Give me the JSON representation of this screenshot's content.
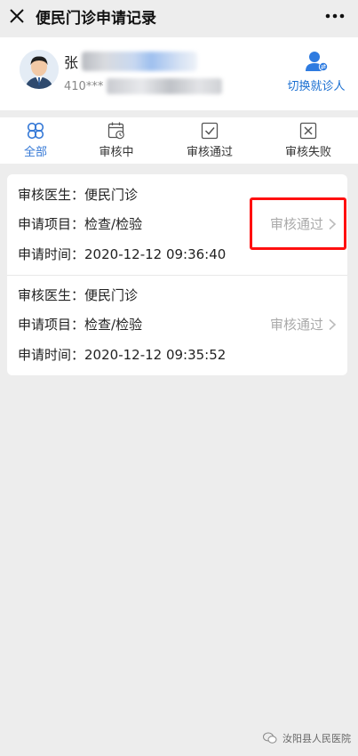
{
  "header": {
    "title": "便民门诊申请记录"
  },
  "user": {
    "name_visible": "张",
    "id_visible": "410***",
    "switch_label": "切换就诊人"
  },
  "tabs": [
    {
      "label": "全部",
      "icon": "four-petal-icon"
    },
    {
      "label": "审核中",
      "icon": "calendar-clock-icon"
    },
    {
      "label": "审核通过",
      "icon": "check-box-icon"
    },
    {
      "label": "审核失败",
      "icon": "cross-box-icon"
    }
  ],
  "records": [
    {
      "doctor_label": "审核医生：",
      "doctor": "便民门诊",
      "item_label": "申请项目：",
      "item": "检查/检验",
      "time_label": "申请时间：",
      "time": "2020-12-12 09:36:40",
      "status": "审核通过"
    },
    {
      "doctor_label": "审核医生：",
      "doctor": "便民门诊",
      "item_label": "申请项目：",
      "item": "检查/检验",
      "time_label": "申请时间：",
      "time": "2020-12-12 09:35:52",
      "status": "审核通过"
    }
  ],
  "watermark": "汝阳县人民医院",
  "colors": {
    "accent": "#3478d6",
    "link": "#1a6fd1",
    "highlight": "#ff0f0f",
    "background": "#ededed"
  }
}
